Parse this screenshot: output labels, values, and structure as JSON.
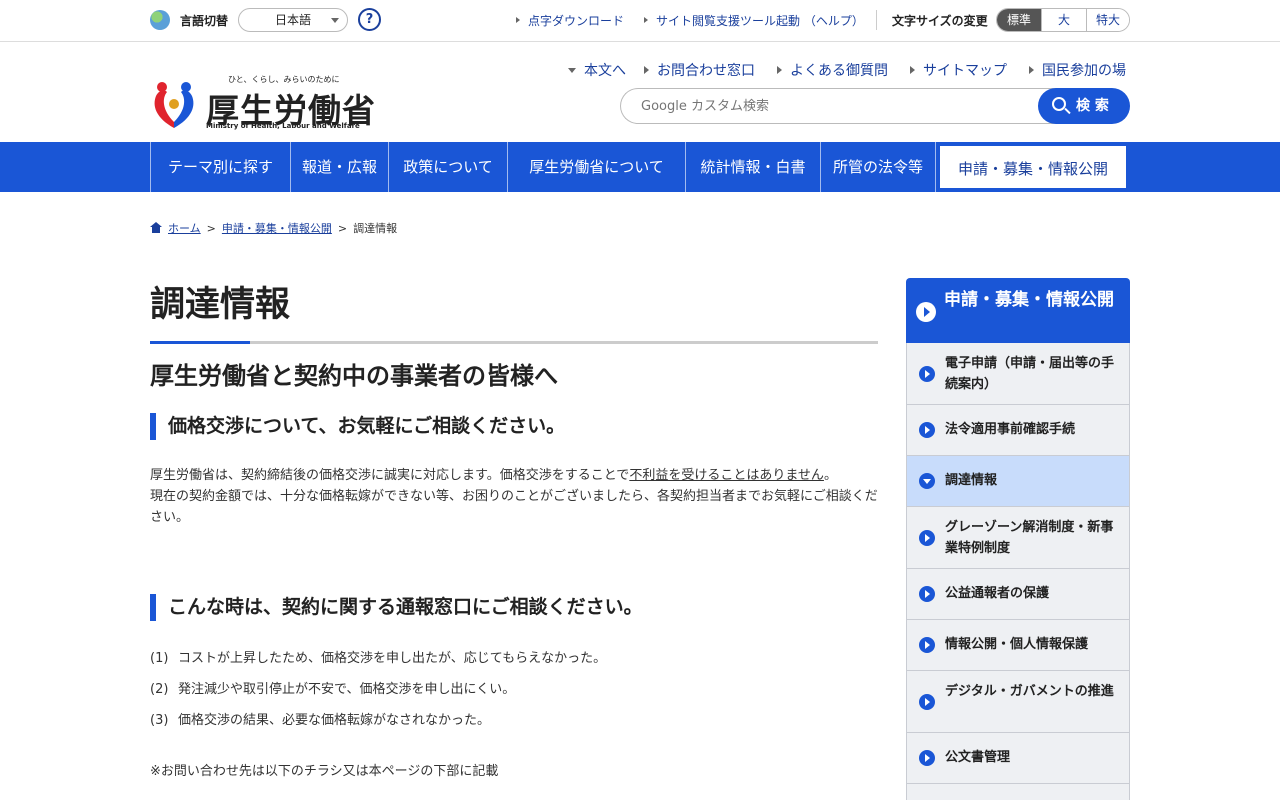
{
  "utility": {
    "lang_label": "言語切替",
    "lang_value": "日本語",
    "help": "?",
    "links": [
      "点字ダウンロード",
      "サイト閲覧支援ツール起動 （ヘルプ）"
    ],
    "fontsize_label": "文字サイズの変更",
    "fontsize": [
      "標準",
      "大",
      "特大"
    ]
  },
  "logo": {
    "tagline": "ひと、くらし、みらいのために",
    "name": "厚生労働省",
    "en": "Ministry of Health, Labour and Welfare"
  },
  "headnav": [
    "本文へ",
    "お問合わせ窓口",
    "よくある御質問",
    "サイトマップ",
    "国民参加の場"
  ],
  "search": {
    "placeholder": "Google カスタム検索",
    "button": "検 索"
  },
  "gnav": [
    "テーマ別に探す",
    "報道・広報",
    "政策について",
    "厚生労働省について",
    "統計情報・白書",
    "所管の法令等",
    "申請・募集・情報公開"
  ],
  "breadcrumb": {
    "home": "ホーム",
    "parent": "申請・募集・情報公開",
    "current": "調達情報",
    "sep": ">"
  },
  "main": {
    "title": "調達情報",
    "h2": "厚生労働省と契約中の事業者の皆様へ",
    "h3a": "価格交渉について、お気軽にご相談ください。",
    "para1_pre": "厚生労働省は、契約締結後の価格交渉に誠実に対応します。価格交渉をすることで",
    "para1_u": "不利益を受けることはありません",
    "para1_post": "。",
    "para2": "現在の契約金額では、十分な価格転嫁ができない等、お困りのことがございましたら、各契約担当者までお気軽にご相談ください。",
    "h3b": "こんな時は、契約に関する通報窓口にご相談ください。",
    "list": [
      {
        "num": "(1)",
        "text": "コストが上昇したため、価格交渉を申し出たが、応じてもらえなかった。"
      },
      {
        "num": "(2)",
        "text": "発注減少や取引停止が不安で、価格交渉を申し出にくい。"
      },
      {
        "num": "(3)",
        "text": "価格交渉の結果、必要な価格転嫁がなされなかった。"
      }
    ],
    "note": "※お問い合わせ先は以下のチラシ又は本ページの下部に記載"
  },
  "side": {
    "head": "申請・募集・情報公開",
    "items": [
      "電子申請（申請・届出等の手続案内）",
      "法令適用事前確認手続",
      "調達情報",
      "グレーゾーン解消制度・新事業特例制度",
      "公益通報者の保護",
      "情報公開・個人情報保護",
      "デジタル・ガバメントの推進",
      "公文書管理"
    ]
  },
  "colors": {
    "brand_blue": "#1a56d6",
    "link_blue": "#1a3f9c",
    "side_active": "#c8dcfb"
  }
}
